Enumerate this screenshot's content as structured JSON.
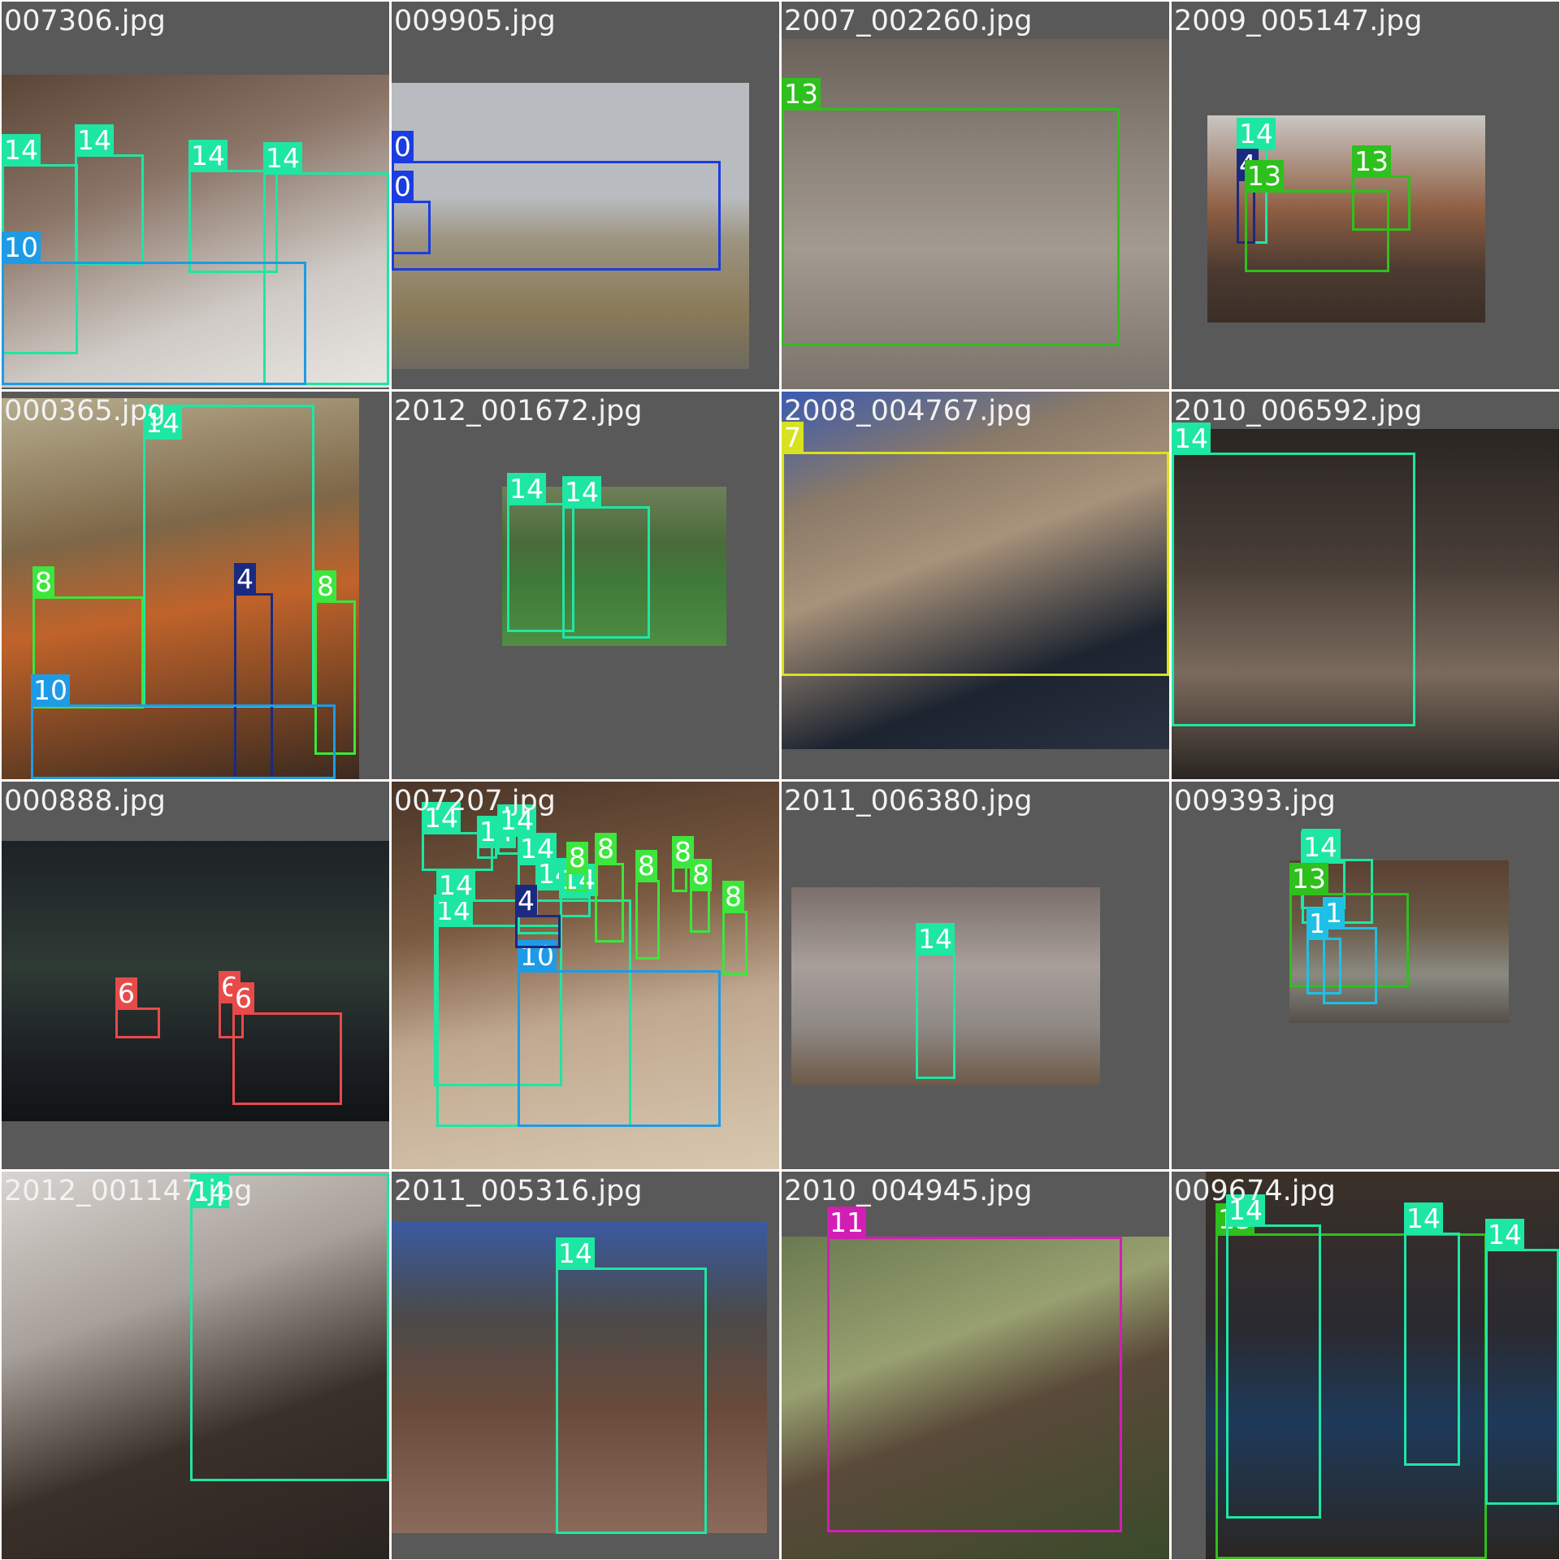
{
  "grid": {
    "tiles": [
      {
        "filename": "007306.jpg",
        "palette": "indoor-warm",
        "boxes": [
          {
            "cls": "14",
            "color": "#1ee6a3"
          },
          {
            "cls": "14",
            "color": "#1ee6a3"
          },
          {
            "cls": "14",
            "color": "#1ee6a3"
          },
          {
            "cls": "14",
            "color": "#1ee6a3"
          },
          {
            "cls": "10",
            "color": "#1e9be6"
          }
        ]
      },
      {
        "filename": "009905.jpg",
        "palette": "airfield",
        "boxes": [
          {
            "cls": "0",
            "color": "#1a3ce0"
          },
          {
            "cls": "0",
            "color": "#1a3ce0"
          }
        ]
      },
      {
        "filename": "2007_002260.jpg",
        "palette": "street-grey",
        "boxes": [
          {
            "cls": "13",
            "color": "#2ec01c"
          }
        ]
      },
      {
        "filename": "2009_005147.jpg",
        "palette": "garage",
        "boxes": [
          {
            "cls": "14",
            "color": "#1ee6a3"
          },
          {
            "cls": "4",
            "color": "#1a2a80"
          },
          {
            "cls": "13",
            "color": "#2ec01c"
          },
          {
            "cls": "13",
            "color": "#2ec01c"
          }
        ]
      },
      {
        "filename": "000365.jpg",
        "palette": "market",
        "boxes": [
          {
            "cls": "14",
            "color": "#1ee6a3"
          },
          {
            "cls": "8",
            "color": "#3ce63c"
          },
          {
            "cls": "4",
            "color": "#1a2a80"
          },
          {
            "cls": "8",
            "color": "#3ce63c"
          },
          {
            "cls": "10",
            "color": "#1e9be6"
          }
        ]
      },
      {
        "filename": "2012_001672.jpg",
        "palette": "soccer",
        "boxes": [
          {
            "cls": "14",
            "color": "#1ee6a3"
          },
          {
            "cls": "14",
            "color": "#1ee6a3"
          }
        ]
      },
      {
        "filename": "2008_004767.jpg",
        "palette": "cat",
        "boxes": [
          {
            "cls": "7",
            "color": "#d8e21e"
          }
        ]
      },
      {
        "filename": "2010_006592.jpg",
        "palette": "men",
        "boxes": [
          {
            "cls": "14",
            "color": "#1ee6a3"
          }
        ]
      },
      {
        "filename": "000888.jpg",
        "palette": "night",
        "boxes": [
          {
            "cls": "6",
            "color": "#e84a4a"
          },
          {
            "cls": "6",
            "color": "#e84a4a"
          },
          {
            "cls": "6",
            "color": "#e84a4a"
          }
        ]
      },
      {
        "filename": "007207.jpg",
        "palette": "restaurant",
        "boxes": [
          {
            "cls": "14",
            "color": "#1ee6a3"
          },
          {
            "cls": "14",
            "color": "#1ee6a3"
          },
          {
            "cls": "14",
            "color": "#1ee6a3"
          },
          {
            "cls": "14",
            "color": "#1ee6a3"
          },
          {
            "cls": "14",
            "color": "#1ee6a3"
          },
          {
            "cls": "14",
            "color": "#1ee6a3"
          },
          {
            "cls": "14",
            "color": "#1ee6a3"
          },
          {
            "cls": "14",
            "color": "#1ee6a3"
          },
          {
            "cls": "8",
            "color": "#3ce63c"
          },
          {
            "cls": "8",
            "color": "#3ce63c"
          },
          {
            "cls": "8",
            "color": "#3ce63c"
          },
          {
            "cls": "8",
            "color": "#3ce63c"
          },
          {
            "cls": "8",
            "color": "#3ce63c"
          },
          {
            "cls": "8",
            "color": "#3ce63c"
          },
          {
            "cls": "10",
            "color": "#1e9be6"
          },
          {
            "cls": "4",
            "color": "#1a2a80"
          }
        ]
      },
      {
        "filename": "2011_006380.jpg",
        "palette": "room",
        "boxes": [
          {
            "cls": "14",
            "color": "#1ee6a3"
          }
        ]
      },
      {
        "filename": "009393.jpg",
        "palette": "city",
        "boxes": [
          {
            "cls": "14",
            "color": "#1ee6a3"
          },
          {
            "cls": "14",
            "color": "#1ee6a3"
          },
          {
            "cls": "13",
            "color": "#2ec01c"
          },
          {
            "cls": "1",
            "color": "#1ec0e6"
          },
          {
            "cls": "1",
            "color": "#1ec0e6"
          }
        ]
      },
      {
        "filename": "2012_001147.jpg",
        "palette": "cafe",
        "boxes": [
          {
            "cls": "14",
            "color": "#1ee6a3"
          }
        ]
      },
      {
        "filename": "2011_005316.jpg",
        "palette": "stone",
        "boxes": [
          {
            "cls": "14",
            "color": "#1ee6a3"
          }
        ]
      },
      {
        "filename": "2010_004945.jpg",
        "palette": "dog",
        "boxes": [
          {
            "cls": "11",
            "color": "#d21eb4"
          }
        ]
      },
      {
        "filename": "009674.jpg",
        "palette": "bikers",
        "boxes": [
          {
            "cls": "13",
            "color": "#2ec01c"
          },
          {
            "cls": "14",
            "color": "#1ee6a3"
          },
          {
            "cls": "14",
            "color": "#1ee6a3"
          },
          {
            "cls": "14",
            "color": "#1ee6a3"
          }
        ]
      }
    ]
  }
}
